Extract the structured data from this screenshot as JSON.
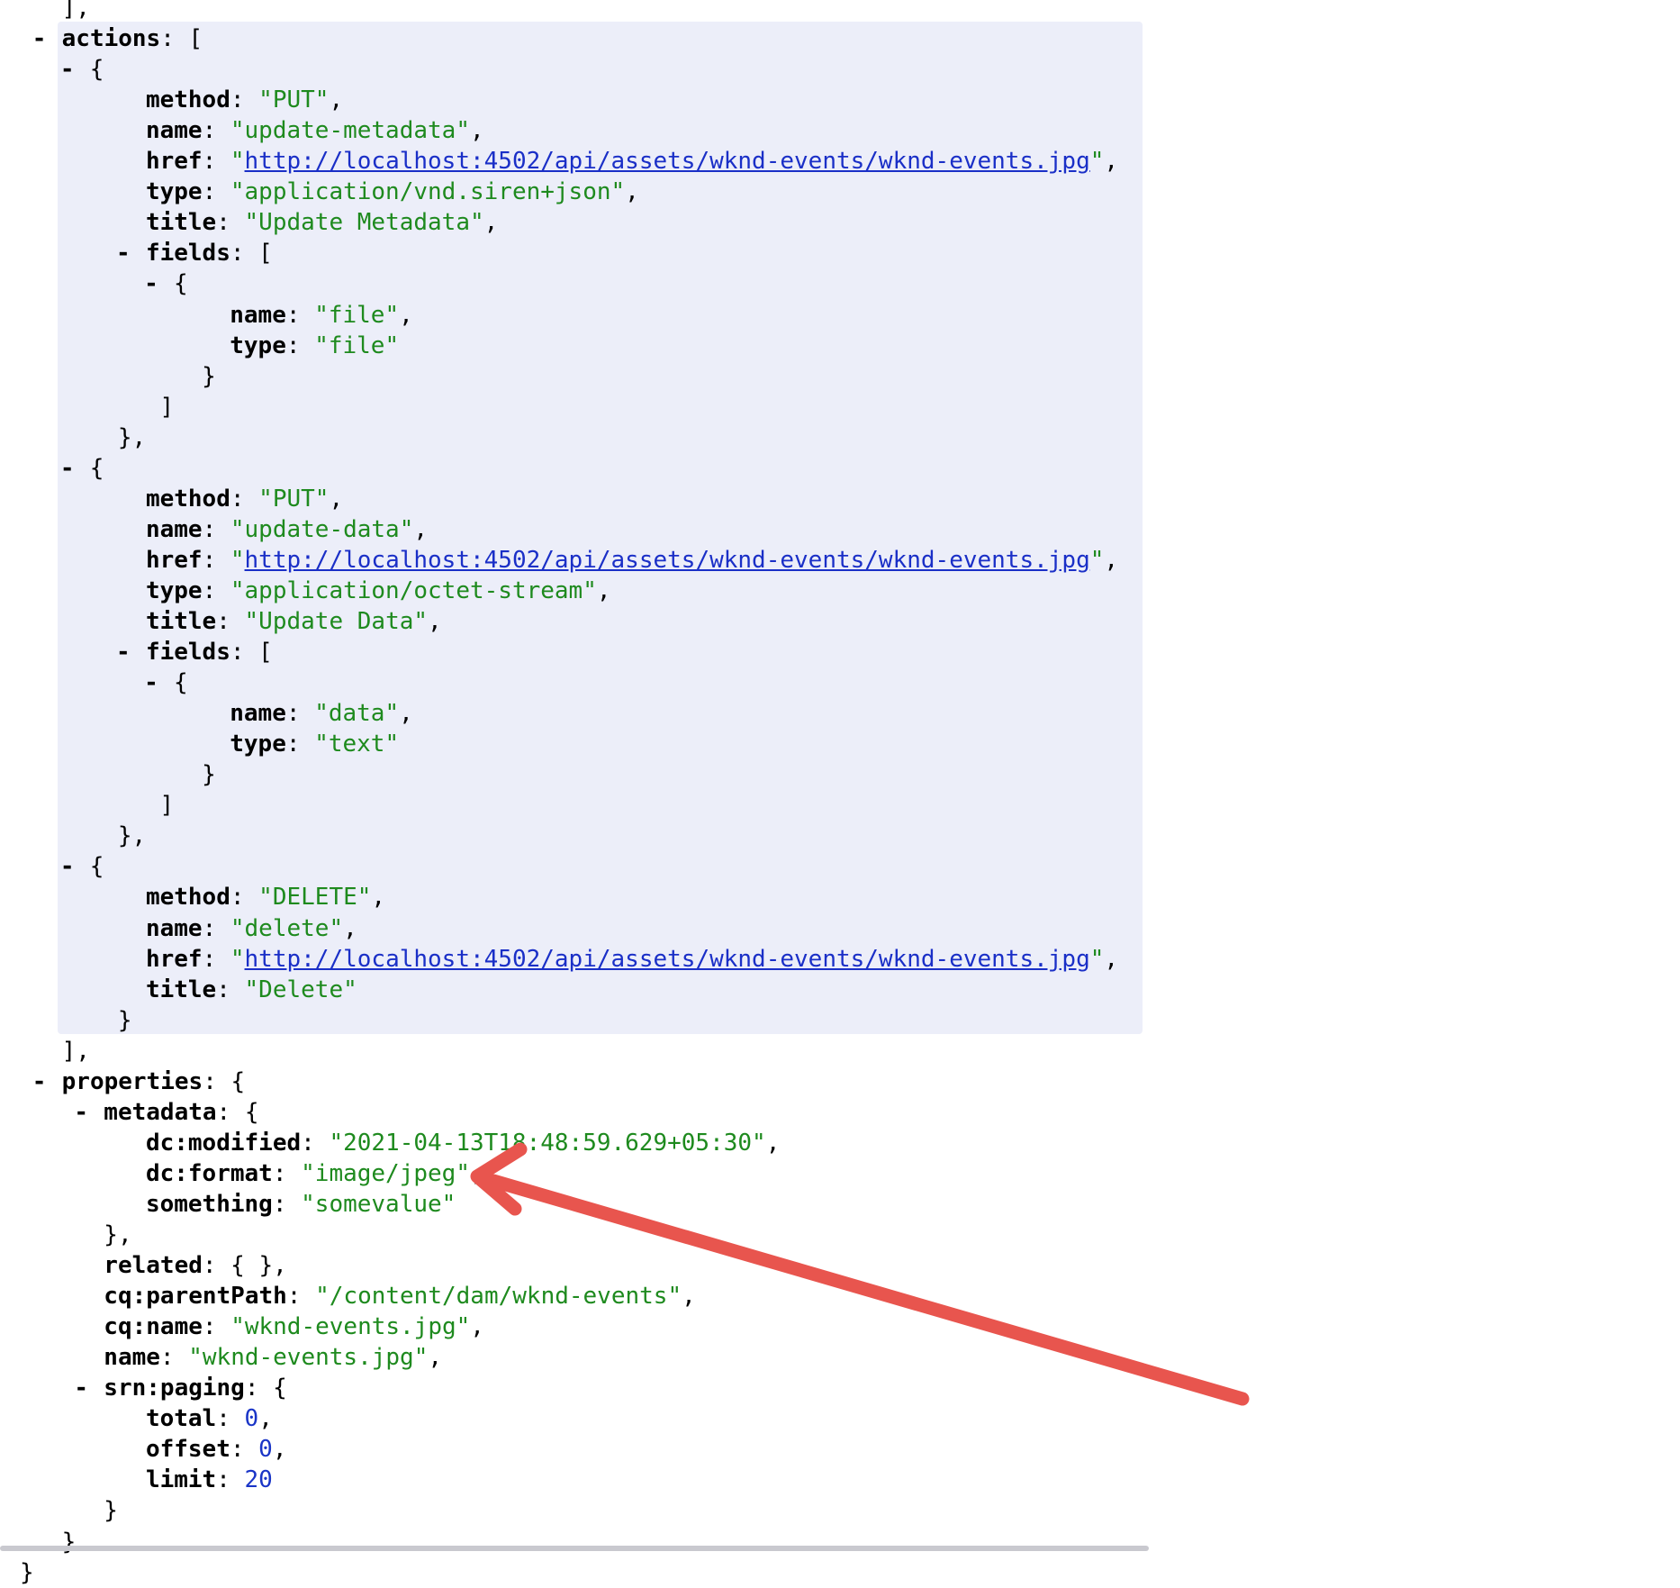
{
  "lines": [
    {
      "i": 3,
      "t": [
        {
          "c": "punct",
          "v": "],"
        }
      ]
    },
    {
      "i": 3,
      "toggle": "-",
      "t": [
        {
          "c": "key",
          "v": "actions"
        },
        {
          "c": "punct",
          "v": ": ["
        }
      ]
    },
    {
      "i": 5,
      "toggle": "-",
      "t": [
        {
          "c": "punct",
          "v": "{"
        }
      ]
    },
    {
      "i": 9,
      "t": [
        {
          "c": "key",
          "v": "method"
        },
        {
          "c": "punct",
          "v": ": "
        },
        {
          "c": "str",
          "v": "\"PUT\""
        },
        {
          "c": "punct",
          "v": ","
        }
      ]
    },
    {
      "i": 9,
      "t": [
        {
          "c": "key",
          "v": "name"
        },
        {
          "c": "punct",
          "v": ": "
        },
        {
          "c": "str",
          "v": "\"update-metadata\""
        },
        {
          "c": "punct",
          "v": ","
        }
      ]
    },
    {
      "i": 9,
      "t": [
        {
          "c": "key",
          "v": "href"
        },
        {
          "c": "punct",
          "v": ": "
        },
        {
          "c": "str",
          "v": "\""
        },
        {
          "c": "link",
          "v": "http://localhost:4502/api/assets/wknd-events/wknd-events.jpg"
        },
        {
          "c": "str",
          "v": "\""
        },
        {
          "c": "punct",
          "v": ","
        }
      ]
    },
    {
      "i": 9,
      "t": [
        {
          "c": "key",
          "v": "type"
        },
        {
          "c": "punct",
          "v": ": "
        },
        {
          "c": "str",
          "v": "\"application/vnd.siren+json\""
        },
        {
          "c": "punct",
          "v": ","
        }
      ]
    },
    {
      "i": 9,
      "t": [
        {
          "c": "key",
          "v": "title"
        },
        {
          "c": "punct",
          "v": ": "
        },
        {
          "c": "str",
          "v": "\"Update Metadata\""
        },
        {
          "c": "punct",
          "v": ","
        }
      ]
    },
    {
      "i": 9,
      "toggle": "-",
      "t": [
        {
          "c": "key",
          "v": "fields"
        },
        {
          "c": "punct",
          "v": ": ["
        }
      ]
    },
    {
      "i": 11,
      "toggle": "-",
      "t": [
        {
          "c": "punct",
          "v": "{"
        }
      ]
    },
    {
      "i": 15,
      "t": [
        {
          "c": "key",
          "v": "name"
        },
        {
          "c": "punct",
          "v": ": "
        },
        {
          "c": "str",
          "v": "\"file\""
        },
        {
          "c": "punct",
          "v": ","
        }
      ]
    },
    {
      "i": 15,
      "t": [
        {
          "c": "key",
          "v": "type"
        },
        {
          "c": "punct",
          "v": ": "
        },
        {
          "c": "str",
          "v": "\"file\""
        }
      ]
    },
    {
      "i": 13,
      "t": [
        {
          "c": "punct",
          "v": "}"
        }
      ]
    },
    {
      "i": 10,
      "t": [
        {
          "c": "punct",
          "v": "]"
        }
      ]
    },
    {
      "i": 7,
      "t": [
        {
          "c": "punct",
          "v": "},"
        }
      ]
    },
    {
      "i": 5,
      "toggle": "-",
      "t": [
        {
          "c": "punct",
          "v": "{"
        }
      ]
    },
    {
      "i": 9,
      "t": [
        {
          "c": "key",
          "v": "method"
        },
        {
          "c": "punct",
          "v": ": "
        },
        {
          "c": "str",
          "v": "\"PUT\""
        },
        {
          "c": "punct",
          "v": ","
        }
      ]
    },
    {
      "i": 9,
      "t": [
        {
          "c": "key",
          "v": "name"
        },
        {
          "c": "punct",
          "v": ": "
        },
        {
          "c": "str",
          "v": "\"update-data\""
        },
        {
          "c": "punct",
          "v": ","
        }
      ]
    },
    {
      "i": 9,
      "t": [
        {
          "c": "key",
          "v": "href"
        },
        {
          "c": "punct",
          "v": ": "
        },
        {
          "c": "str",
          "v": "\""
        },
        {
          "c": "link",
          "v": "http://localhost:4502/api/assets/wknd-events/wknd-events.jpg"
        },
        {
          "c": "str",
          "v": "\""
        },
        {
          "c": "punct",
          "v": ","
        }
      ]
    },
    {
      "i": 9,
      "t": [
        {
          "c": "key",
          "v": "type"
        },
        {
          "c": "punct",
          "v": ": "
        },
        {
          "c": "str",
          "v": "\"application/octet-stream\""
        },
        {
          "c": "punct",
          "v": ","
        }
      ]
    },
    {
      "i": 9,
      "t": [
        {
          "c": "key",
          "v": "title"
        },
        {
          "c": "punct",
          "v": ": "
        },
        {
          "c": "str",
          "v": "\"Update Data\""
        },
        {
          "c": "punct",
          "v": ","
        }
      ]
    },
    {
      "i": 9,
      "toggle": "-",
      "t": [
        {
          "c": "key",
          "v": "fields"
        },
        {
          "c": "punct",
          "v": ": ["
        }
      ]
    },
    {
      "i": 11,
      "toggle": "-",
      "t": [
        {
          "c": "punct",
          "v": "{"
        }
      ]
    },
    {
      "i": 15,
      "t": [
        {
          "c": "key",
          "v": "name"
        },
        {
          "c": "punct",
          "v": ": "
        },
        {
          "c": "str",
          "v": "\"data\""
        },
        {
          "c": "punct",
          "v": ","
        }
      ]
    },
    {
      "i": 15,
      "t": [
        {
          "c": "key",
          "v": "type"
        },
        {
          "c": "punct",
          "v": ": "
        },
        {
          "c": "str",
          "v": "\"text\""
        }
      ]
    },
    {
      "i": 13,
      "t": [
        {
          "c": "punct",
          "v": "}"
        }
      ]
    },
    {
      "i": 10,
      "t": [
        {
          "c": "punct",
          "v": "]"
        }
      ]
    },
    {
      "i": 7,
      "t": [
        {
          "c": "punct",
          "v": "},"
        }
      ]
    },
    {
      "i": 5,
      "toggle": "-",
      "t": [
        {
          "c": "punct",
          "v": "{"
        }
      ]
    },
    {
      "i": 9,
      "t": [
        {
          "c": "key",
          "v": "method"
        },
        {
          "c": "punct",
          "v": ": "
        },
        {
          "c": "str",
          "v": "\"DELETE\""
        },
        {
          "c": "punct",
          "v": ","
        }
      ]
    },
    {
      "i": 9,
      "t": [
        {
          "c": "key",
          "v": "name"
        },
        {
          "c": "punct",
          "v": ": "
        },
        {
          "c": "str",
          "v": "\"delete\""
        },
        {
          "c": "punct",
          "v": ","
        }
      ]
    },
    {
      "i": 9,
      "t": [
        {
          "c": "key",
          "v": "href"
        },
        {
          "c": "punct",
          "v": ": "
        },
        {
          "c": "str",
          "v": "\""
        },
        {
          "c": "link",
          "v": "http://localhost:4502/api/assets/wknd-events/wknd-events.jpg"
        },
        {
          "c": "str",
          "v": "\""
        },
        {
          "c": "punct",
          "v": ","
        }
      ]
    },
    {
      "i": 9,
      "t": [
        {
          "c": "key",
          "v": "title"
        },
        {
          "c": "punct",
          "v": ": "
        },
        {
          "c": "str",
          "v": "\"Delete\""
        }
      ]
    },
    {
      "i": 7,
      "t": [
        {
          "c": "punct",
          "v": "}"
        }
      ]
    },
    {
      "i": 3,
      "t": [
        {
          "c": "punct",
          "v": "],"
        }
      ]
    },
    {
      "i": 3,
      "toggle": "-",
      "t": [
        {
          "c": "key",
          "v": "properties"
        },
        {
          "c": "punct",
          "v": ": {"
        }
      ]
    },
    {
      "i": 6,
      "toggle": "-",
      "t": [
        {
          "c": "key",
          "v": "metadata"
        },
        {
          "c": "punct",
          "v": ": {"
        }
      ]
    },
    {
      "i": 9,
      "t": [
        {
          "c": "key",
          "v": "dc:modified"
        },
        {
          "c": "punct",
          "v": ": "
        },
        {
          "c": "str",
          "v": "\"2021-04-13T18:48:59.629+05:30\""
        },
        {
          "c": "punct",
          "v": ","
        }
      ]
    },
    {
      "i": 9,
      "t": [
        {
          "c": "key",
          "v": "dc:format"
        },
        {
          "c": "punct",
          "v": ": "
        },
        {
          "c": "str",
          "v": "\"image/jpeg\""
        },
        {
          "c": "punct",
          "v": ","
        }
      ]
    },
    {
      "i": 9,
      "t": [
        {
          "c": "key",
          "v": "something"
        },
        {
          "c": "punct",
          "v": ": "
        },
        {
          "c": "str",
          "v": "\"somevalue\""
        }
      ]
    },
    {
      "i": 6,
      "t": [
        {
          "c": "punct",
          "v": "},"
        }
      ]
    },
    {
      "i": 6,
      "t": [
        {
          "c": "key",
          "v": "related"
        },
        {
          "c": "punct",
          "v": ": { },"
        }
      ]
    },
    {
      "i": 6,
      "t": [
        {
          "c": "key",
          "v": "cq:parentPath"
        },
        {
          "c": "punct",
          "v": ": "
        },
        {
          "c": "str",
          "v": "\"/content/dam/wknd-events\""
        },
        {
          "c": "punct",
          "v": ","
        }
      ]
    },
    {
      "i": 6,
      "t": [
        {
          "c": "key",
          "v": "cq:name"
        },
        {
          "c": "punct",
          "v": ": "
        },
        {
          "c": "str",
          "v": "\"wknd-events.jpg\""
        },
        {
          "c": "punct",
          "v": ","
        }
      ]
    },
    {
      "i": 6,
      "t": [
        {
          "c": "key",
          "v": "name"
        },
        {
          "c": "punct",
          "v": ": "
        },
        {
          "c": "str",
          "v": "\"wknd-events.jpg\""
        },
        {
          "c": "punct",
          "v": ","
        }
      ]
    },
    {
      "i": 6,
      "toggle": "-",
      "t": [
        {
          "c": "key",
          "v": "srn:paging"
        },
        {
          "c": "punct",
          "v": ": {"
        }
      ]
    },
    {
      "i": 9,
      "t": [
        {
          "c": "key",
          "v": "total"
        },
        {
          "c": "punct",
          "v": ": "
        },
        {
          "c": "num",
          "v": "0"
        },
        {
          "c": "punct",
          "v": ","
        }
      ]
    },
    {
      "i": 9,
      "t": [
        {
          "c": "key",
          "v": "offset"
        },
        {
          "c": "punct",
          "v": ": "
        },
        {
          "c": "num",
          "v": "0"
        },
        {
          "c": "punct",
          "v": ","
        }
      ]
    },
    {
      "i": 9,
      "t": [
        {
          "c": "key",
          "v": "limit"
        },
        {
          "c": "punct",
          "v": ": "
        },
        {
          "c": "num",
          "v": "20"
        }
      ]
    },
    {
      "i": 6,
      "t": [
        {
          "c": "punct",
          "v": "}"
        }
      ]
    },
    {
      "i": 3,
      "t": [
        {
          "c": "punct",
          "v": "}"
        }
      ]
    },
    {
      "i": 0,
      "t": [
        {
          "c": "punct",
          "v": "}"
        }
      ]
    }
  ],
  "colors": {
    "string": "#1e8a1e",
    "number": "#1a35c7",
    "link": "#1a2fc7",
    "highlight": "#eceef9",
    "arrow": "#e8554e"
  }
}
